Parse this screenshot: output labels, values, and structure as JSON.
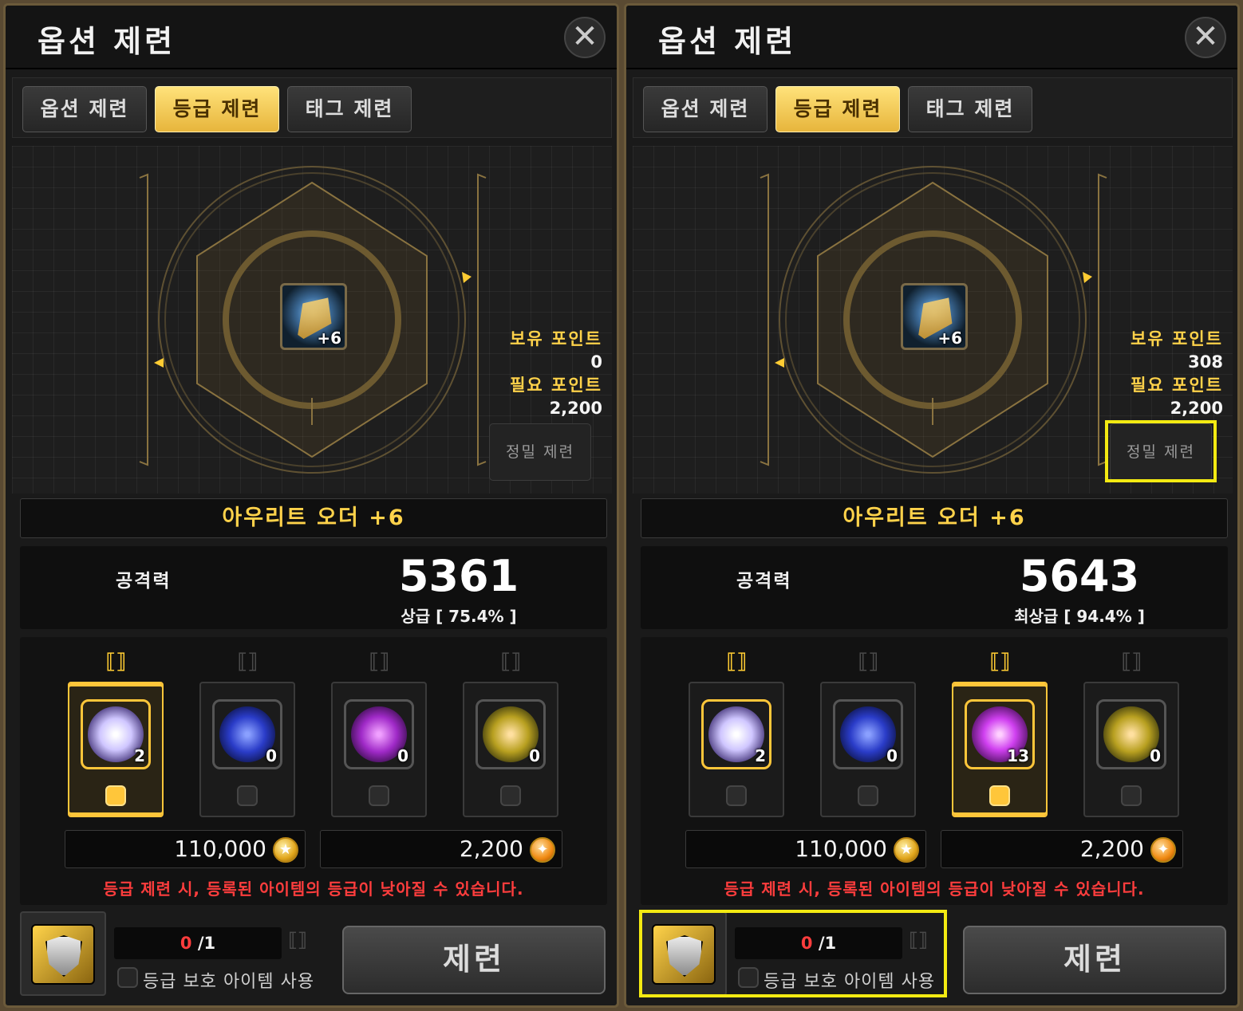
{
  "panels": [
    {
      "title": "옵션 제련",
      "close": "✕",
      "tabs": [
        "옵션 제련",
        "등급 제련",
        "태그 제련"
      ],
      "active_tab": "등급 제련",
      "item_level": "+6",
      "owned_points_label": "보유 포인트",
      "owned_points": "0",
      "required_points_label": "필요 포인트",
      "required_points": "2,200",
      "precise_button": "정밀 제련",
      "item_name": "아우리트 오더 +6",
      "stat_label": "공격력",
      "stat_value": "5361",
      "grade_text": "상급 [ 75.4% ]",
      "slots": [
        {
          "count": "2",
          "active": true,
          "color": "#cfc6ff"
        },
        {
          "count": "0",
          "active": false,
          "color": "#2a3cc8"
        },
        {
          "count": "0",
          "active": false,
          "color": "#a02ac8"
        },
        {
          "count": "0",
          "active": false,
          "color": "#b8a020"
        }
      ],
      "gold_cost": "110,000",
      "point_cost": "2,200",
      "warning": "등급 제련 시, 등록된 아이템의 등급이 낮아질 수 있습니다.",
      "protect_count": "0",
      "protect_max": " /1",
      "protect_label": "등급 보호 아이템 사용",
      "refine_button": "제련"
    },
    {
      "title": "옵션 제련",
      "close": "✕",
      "tabs": [
        "옵션 제련",
        "등급 제련",
        "태그 제련"
      ],
      "active_tab": "등급 제련",
      "item_level": "+6",
      "owned_points_label": "보유 포인트",
      "owned_points": "308",
      "required_points_label": "필요 포인트",
      "required_points": "2,200",
      "precise_button": "정밀 제련",
      "item_name": "아우리트 오더 +6",
      "stat_label": "공격력",
      "stat_value": "5643",
      "grade_text": "최상급 [ 94.4% ]",
      "slots": [
        {
          "count": "2",
          "active": false,
          "color": "#cfc6ff"
        },
        {
          "count": "0",
          "active": false,
          "color": "#2a3cc8"
        },
        {
          "count": "13",
          "active": true,
          "color": "#d040f0"
        },
        {
          "count": "0",
          "active": false,
          "color": "#b8a020"
        }
      ],
      "gold_cost": "110,000",
      "point_cost": "2,200",
      "warning": "등급 제련 시, 등록된 아이템의 등급이 낮아질 수 있습니다.",
      "protect_count": "0",
      "protect_max": " /1",
      "protect_label": "등급 보호 아이템 사용",
      "refine_button": "제련"
    }
  ],
  "colors": {
    "accent": "#ffd24a",
    "highlight": "#f3ea12",
    "warning": "#ff3d3d"
  }
}
